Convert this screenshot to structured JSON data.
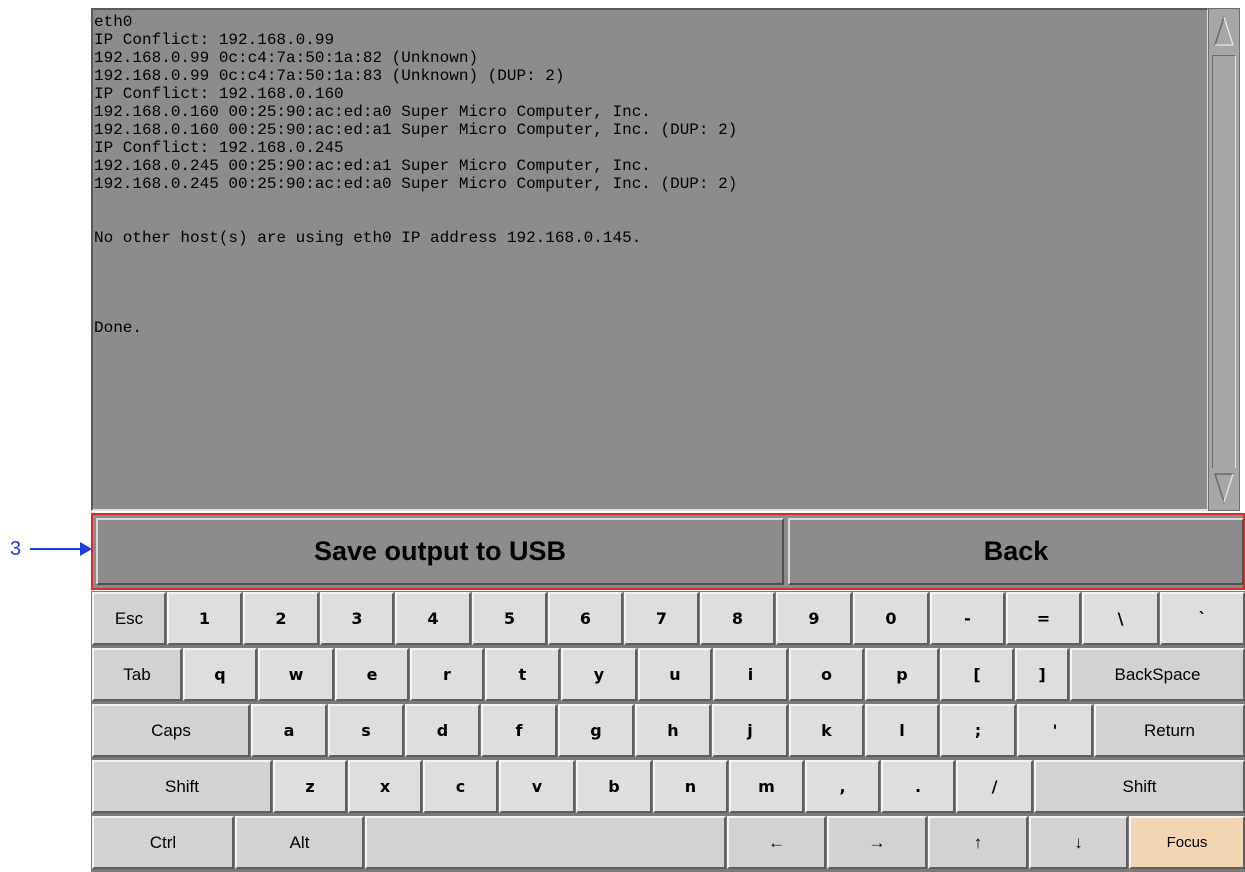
{
  "callout": {
    "number": "3"
  },
  "terminal": {
    "lines": [
      "eth0",
      "IP Conflict: 192.168.0.99",
      "192.168.0.99 0c:c4:7a:50:1a:82 (Unknown)",
      "192.168.0.99 0c:c4:7a:50:1a:83 (Unknown) (DUP: 2)",
      "IP Conflict: 192.168.0.160",
      "192.168.0.160 00:25:90:ac:ed:a0 Super Micro Computer, Inc.",
      "192.168.0.160 00:25:90:ac:ed:a1 Super Micro Computer, Inc. (DUP: 2)",
      "IP Conflict: 192.168.0.245",
      "192.168.0.245 00:25:90:ac:ed:a1 Super Micro Computer, Inc.",
      "192.168.0.245 00:25:90:ac:ed:a0 Super Micro Computer, Inc. (DUP: 2)",
      "",
      "",
      "No other host(s) are using eth0 IP address 192.168.0.145.",
      "",
      "",
      "",
      "",
      "Done."
    ]
  },
  "actions": {
    "save_label": "Save output to USB",
    "back_label": "Back"
  },
  "keyboard": {
    "row1": [
      "Esc",
      "1",
      "2",
      "3",
      "4",
      "5",
      "6",
      "7",
      "8",
      "9",
      "0",
      "-",
      "=",
      "\\",
      "`"
    ],
    "row2": [
      "Tab",
      "q",
      "w",
      "e",
      "r",
      "t",
      "y",
      "u",
      "i",
      "o",
      "p",
      "[",
      "]",
      "BackSpace"
    ],
    "row3": [
      "Caps",
      "a",
      "s",
      "d",
      "f",
      "g",
      "h",
      "j",
      "k",
      "l",
      ";",
      "'",
      "Return"
    ],
    "row4": [
      "Shift",
      "z",
      "x",
      "c",
      "v",
      "b",
      "n",
      "m",
      ",",
      ".",
      "/",
      "Shift"
    ],
    "row5": [
      "Ctrl",
      "Alt",
      "",
      "←",
      "→",
      "↑",
      "↓",
      "Focus"
    ]
  }
}
